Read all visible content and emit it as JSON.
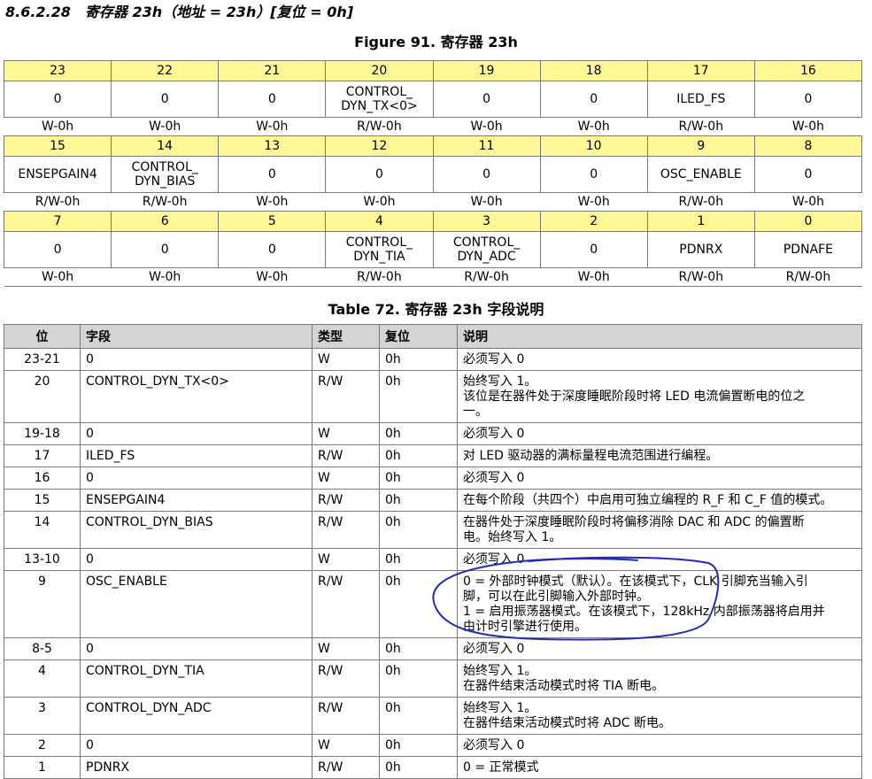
{
  "section_title": "8.6.2.28　寄存器 23h（地址 = 23h）[复位 = 0h]",
  "figure_title": "Figure 91.  寄存器 23h",
  "register_rows": [
    {
      "bits": [
        "23",
        "22",
        "21",
        "20",
        "19",
        "18",
        "17",
        "16"
      ],
      "names": [
        [
          "0"
        ],
        [
          "0"
        ],
        [
          "0"
        ],
        [
          "CONTROL_",
          "DYN_TX<0>"
        ],
        [
          "0"
        ],
        [
          "0"
        ],
        [
          "ILED_FS"
        ],
        [
          "0"
        ]
      ],
      "resets": [
        "W-0h",
        "W-0h",
        "W-0h",
        "R/W-0h",
        "W-0h",
        "W-0h",
        "R/W-0h",
        "W-0h"
      ]
    },
    {
      "bits": [
        "15",
        "14",
        "13",
        "12",
        "11",
        "10",
        "9",
        "8"
      ],
      "names": [
        [
          "ENSEPGAIN4"
        ],
        [
          "CONTROL_",
          "DYN_BIAS"
        ],
        [
          "0"
        ],
        [
          "0"
        ],
        [
          "0"
        ],
        [
          "0"
        ],
        [
          "OSC_ENABLE"
        ],
        [
          "0"
        ]
      ],
      "resets": [
        "R/W-0h",
        "R/W-0h",
        "W-0h",
        "W-0h",
        "W-0h",
        "W-0h",
        "R/W-0h",
        "W-0h"
      ]
    },
    {
      "bits": [
        "7",
        "6",
        "5",
        "4",
        "3",
        "2",
        "1",
        "0"
      ],
      "names": [
        [
          "0"
        ],
        [
          "0"
        ],
        [
          "0"
        ],
        [
          "CONTROL_",
          "DYN_TIA"
        ],
        [
          "CONTROL_",
          "DYN_ADC"
        ],
        [
          "0"
        ],
        [
          "PDNRX"
        ],
        [
          "PDNAFE"
        ]
      ],
      "resets": [
        "W-0h",
        "W-0h",
        "W-0h",
        "R/W-0h",
        "R/W-0h",
        "W-0h",
        "R/W-0h",
        "R/W-0h"
      ]
    }
  ],
  "table_title": "Table 72. 寄存器 23h 字段说明",
  "columns": [
    "位",
    "字段",
    "类型",
    "复位",
    "说明"
  ],
  "fields": [
    {
      "bit": "23-21",
      "field": "0",
      "type": "W",
      "reset": "0h",
      "desc": [
        "必须写入 0"
      ]
    },
    {
      "bit": "20",
      "field": "CONTROL_DYN_TX<0>",
      "type": "R/W",
      "reset": "0h",
      "desc": [
        "始终写入 1。",
        "该位是在器件处于深度睡眠阶段时将 LED 电流偏置断电的位之",
        "一。"
      ]
    },
    {
      "bit": "19-18",
      "field": "0",
      "type": "W",
      "reset": "0h",
      "desc": [
        "必须写入 0"
      ]
    },
    {
      "bit": "17",
      "field": "ILED_FS",
      "type": "R/W",
      "reset": "0h",
      "desc": [
        "对 LED 驱动器的满标量程电流范围进行编程。"
      ]
    },
    {
      "bit": "16",
      "field": "0",
      "type": "W",
      "reset": "0h",
      "desc": [
        "必须写入 0"
      ]
    },
    {
      "bit": "15",
      "field": "ENSEPGAIN4",
      "type": "R/W",
      "reset": "0h",
      "desc": [
        "在每个阶段（共四个）中启用可独立编程的 R_F 和 C_F 值的模式。"
      ]
    },
    {
      "bit": "14",
      "field": "CONTROL_DYN_BIAS",
      "type": "R/W",
      "reset": "0h",
      "desc": [
        "在器件处于深度睡眠阶段时将偏移消除 DAC 和 ADC 的偏置断",
        "电。始终写入 1。"
      ]
    },
    {
      "bit": "13-10",
      "field": "0",
      "type": "W",
      "reset": "0h",
      "desc": [
        "必须写入 0"
      ]
    },
    {
      "bit": "9",
      "field": "OSC_ENABLE",
      "type": "R/W",
      "reset": "0h",
      "desc": [
        "0 = 外部时钟模式（默认）。在该模式下，CLK 引脚充当输入引",
        "脚，可以在此引脚输入外部时钟。",
        "1 = 启用振荡器模式。在该模式下，128kHz 内部振荡器将启用并",
        "由计时引擎进行使用。"
      ]
    },
    {
      "bit": "8-5",
      "field": "0",
      "type": "W",
      "reset": "0h",
      "desc": [
        "必须写入 0"
      ]
    },
    {
      "bit": "4",
      "field": "CONTROL_DYN_TIA",
      "type": "R/W",
      "reset": "0h",
      "desc": [
        "始终写入 1。",
        "在器件结束活动模式时将 TIA 断电。"
      ]
    },
    {
      "bit": "3",
      "field": "CONTROL_DYN_ADC",
      "type": "R/W",
      "reset": "0h",
      "desc": [
        "始终写入 1。",
        "在器件结束活动模式时将 ADC 断电。"
      ]
    },
    {
      "bit": "2",
      "field": "0",
      "type": "W",
      "reset": "0h",
      "desc": [
        "必须写入 0"
      ]
    },
    {
      "bit": "1",
      "field": "PDNRX",
      "type": "R/W",
      "reset": "0h",
      "desc": [
        "0 = 正常模式"
      ]
    }
  ],
  "colors": {
    "bit_row_bg": "#fff896",
    "header_bg": "#d4d4d4",
    "border": "#7a7a7a",
    "annotation_ink": "#1f2fb0"
  }
}
